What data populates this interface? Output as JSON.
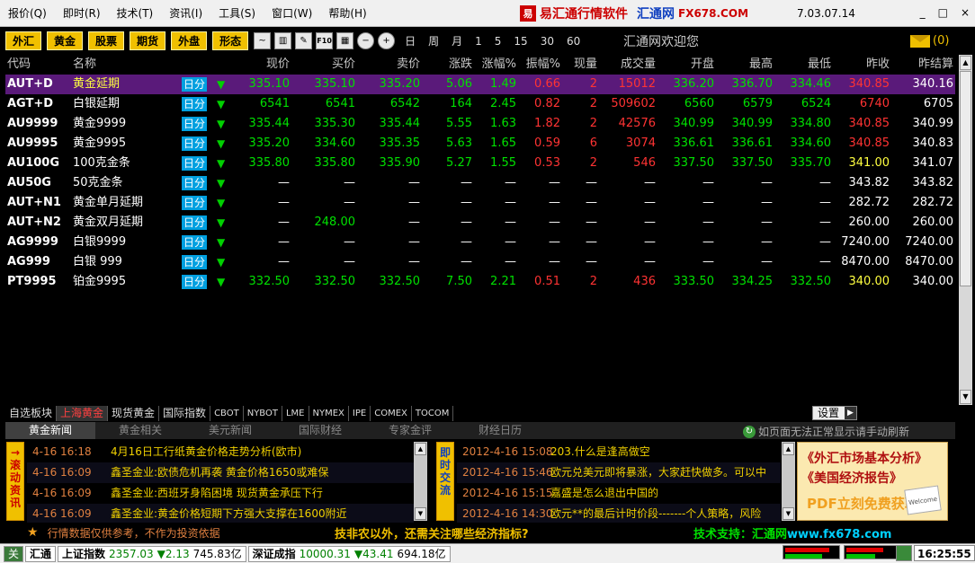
{
  "menu": [
    "报价(Q)",
    "即时(R)",
    "技术(T)",
    "资讯(I)",
    "工具(S)",
    "窗口(W)",
    "帮助(H)"
  ],
  "brand": {
    "name": "易汇通行情软件",
    "site": "汇通网",
    "domain": "FX678.COM",
    "logo": "易"
  },
  "version": "7.03.07.14",
  "window_buttons": [
    "_",
    "□",
    "×"
  ],
  "toolbar": {
    "markets": [
      "外汇",
      "黄金",
      "股票",
      "期货",
      "外盘",
      "形态"
    ],
    "tool_icons": [
      {
        "icon": "line-chart-icon",
        "text": "~"
      },
      {
        "icon": "candle-chart-icon",
        "text": "▥"
      },
      {
        "icon": "pen-icon",
        "text": "✎"
      },
      {
        "icon": "f10-icon",
        "text": "F10"
      },
      {
        "icon": "grid-icon",
        "text": "▦"
      },
      {
        "icon": "zoom-out-icon",
        "text": "−"
      },
      {
        "icon": "zoom-in-icon",
        "text": "+"
      }
    ],
    "periods": [
      "日",
      "周",
      "月",
      "1",
      "5",
      "15",
      "30",
      "60"
    ],
    "welcome": "汇通网欢迎您",
    "mail_count": "(0)"
  },
  "table": {
    "headers": [
      "代码",
      "名称",
      "现价",
      "买价",
      "卖价",
      "涨跌",
      "涨幅%",
      "振幅%",
      "现量",
      "成交量",
      "开盘",
      "最高",
      "最低",
      "昨收",
      "昨结算"
    ],
    "rows": [
      {
        "code": "AUT+D",
        "name": "黄金延期",
        "badge": "日分",
        "cur": "335.10",
        "bid": "335.10",
        "ask": "335.20",
        "chg": "5.06",
        "pct": "1.49",
        "amp": "0.66",
        "vol": "2",
        "tvol": "15012",
        "open": "336.20",
        "high": "336.70",
        "low": "334.46",
        "prev": "340.85",
        "settle": "340.16"
      },
      {
        "code": "AGT+D",
        "name": "白银延期",
        "badge": "日分",
        "cur": "6541",
        "bid": "6541",
        "ask": "6542",
        "chg": "164",
        "pct": "2.45",
        "amp": "0.82",
        "vol": "2",
        "tvol": "509602",
        "open": "6560",
        "high": "6579",
        "low": "6524",
        "prev": "6740",
        "settle": "6705"
      },
      {
        "code": "AU9999",
        "name": "黄金9999",
        "badge": "日分",
        "cur": "335.44",
        "bid": "335.30",
        "ask": "335.44",
        "chg": "5.55",
        "pct": "1.63",
        "amp": "1.82",
        "vol": "2",
        "tvol": "42576",
        "open": "340.99",
        "high": "340.99",
        "low": "334.80",
        "prev": "340.85",
        "settle": "340.99"
      },
      {
        "code": "AU9995",
        "name": "黄金9995",
        "badge": "日分",
        "cur": "335.20",
        "bid": "334.60",
        "ask": "335.35",
        "chg": "5.63",
        "pct": "1.65",
        "amp": "0.59",
        "vol": "6",
        "tvol": "3074",
        "open": "336.61",
        "high": "336.61",
        "low": "334.60",
        "prev": "340.85",
        "settle": "340.83"
      },
      {
        "code": "AU100G",
        "name": "100克金条",
        "badge": "日分",
        "cur": "335.80",
        "bid": "335.80",
        "ask": "335.90",
        "chg": "5.27",
        "pct": "1.55",
        "amp": "0.53",
        "vol": "2",
        "tvol": "546",
        "open": "337.50",
        "high": "337.50",
        "low": "335.70",
        "prev": "341.00",
        "settle": "341.07"
      },
      {
        "code": "AU50G",
        "name": "50克金条",
        "badge": "日分",
        "cur": "—",
        "bid": "—",
        "ask": "—",
        "chg": "—",
        "pct": "—",
        "amp": "—",
        "vol": "—",
        "tvol": "—",
        "open": "—",
        "high": "—",
        "low": "—",
        "prev": "343.82",
        "settle": "343.82"
      },
      {
        "code": "AUT+N1",
        "name": "黄金单月延期",
        "badge": "日分",
        "cur": "—",
        "bid": "—",
        "ask": "—",
        "chg": "—",
        "pct": "—",
        "amp": "—",
        "vol": "—",
        "tvol": "—",
        "open": "—",
        "high": "—",
        "low": "—",
        "prev": "282.72",
        "settle": "282.72"
      },
      {
        "code": "AUT+N2",
        "name": "黄金双月延期",
        "badge": "日分",
        "cur": "—",
        "bid": "248.00",
        "ask": "—",
        "chg": "—",
        "pct": "—",
        "amp": "—",
        "vol": "—",
        "tvol": "—",
        "open": "—",
        "high": "—",
        "low": "—",
        "prev": "260.00",
        "settle": "260.00"
      },
      {
        "code": "AG9999",
        "name": "白银9999",
        "badge": "日分",
        "cur": "—",
        "bid": "—",
        "ask": "—",
        "chg": "—",
        "pct": "—",
        "amp": "—",
        "vol": "—",
        "tvol": "—",
        "open": "—",
        "high": "—",
        "low": "—",
        "prev": "7240.00",
        "settle": "7240.00"
      },
      {
        "code": "AG999",
        "name": "白银 999",
        "badge": "日分",
        "cur": "—",
        "bid": "—",
        "ask": "—",
        "chg": "—",
        "pct": "—",
        "amp": "—",
        "vol": "—",
        "tvol": "—",
        "open": "—",
        "high": "—",
        "low": "—",
        "prev": "8470.00",
        "settle": "8470.00"
      },
      {
        "code": "PT9995",
        "name": "铂金9995",
        "badge": "日分",
        "cur": "332.50",
        "bid": "332.50",
        "ask": "332.50",
        "chg": "7.50",
        "pct": "2.21",
        "amp": "0.51",
        "vol": "2",
        "tvol": "436",
        "open": "333.50",
        "high": "334.25",
        "low": "332.50",
        "prev": "340.00",
        "settle": "340.00"
      }
    ]
  },
  "market_tabs": [
    "自选板块",
    "上海黄金",
    "现货黄金",
    "国际指数",
    "CBOT",
    "NYBOT",
    "LME",
    "NYMEX",
    "IPE",
    "COMEX",
    "TOCOM"
  ],
  "settings_label": "设置",
  "news_tabs": [
    "黄金新闻",
    "黄金相关",
    "美元新闻",
    "国际财经",
    "专家金评",
    "财经日历"
  ],
  "refresh_text": "如页面无法正常显示请手动刷新",
  "news_left_label": "→滚动资讯",
  "news_left": [
    {
      "time": "4-16 16:18",
      "title": "4月16日工行纸黄金价格走势分析(欧市)"
    },
    {
      "time": "4-16 16:09",
      "title": "鑫圣金业:欧债危机再袭 黄金价格1650或难保"
    },
    {
      "time": "4-16 16:09",
      "title": "鑫圣金业:西班牙身陷困境 现货黄金承压下行"
    },
    {
      "time": "4-16 16:09",
      "title": "鑫圣金业:黄金价格短期下方强大支撑在1600附近"
    }
  ],
  "news_right_label": "即时交流",
  "news_right": [
    {
      "time": "2012-4-16 15:08",
      "title": "203.什么是逢高做空"
    },
    {
      "time": "2012-4-16 15:46",
      "title": "欧元兑美元即将暴涨，大家赶快做多。可以中"
    },
    {
      "time": "2012-4-16 15:15",
      "title": "嘉盛是怎么退出中国的"
    },
    {
      "time": "2012-4-16 14:30",
      "title": "欧元**的最后计时价段-------个人策略，风险"
    }
  ],
  "ad": {
    "line1": "《外汇市场基本分析》",
    "line2": "《美国经济报告》",
    "line3": "PDF立刻免费获取→",
    "card": "Welcome"
  },
  "info": {
    "disclaimer": "行情数据仅供参考，不作为投资依据",
    "question": "技非农以外，还需关注哪些经济指标?",
    "support": "技术支持：汇通网",
    "support_url": "www.fx678.com"
  },
  "status": {
    "left_icon": "关",
    "app": "汇通",
    "sh_label": "上证指数",
    "sh_val": "2357.03",
    "sh_chg": "▼2.13",
    "sh_amt": "745.83亿",
    "sz_label": "深证成指",
    "sz_val": "10000.31",
    "sz_chg": "▼43.41",
    "sz_amt": "694.18亿",
    "time": "16:25:55"
  },
  "meters": [
    {
      "red": 0.85,
      "green": 0.7
    },
    {
      "red": 0.7,
      "green": 0.55
    }
  ],
  "colors": {
    "up": "#ff3333",
    "down": "#00e000",
    "accent": "#f0c000",
    "badge": "#00a0e0",
    "selected": "#5a1a7a"
  }
}
